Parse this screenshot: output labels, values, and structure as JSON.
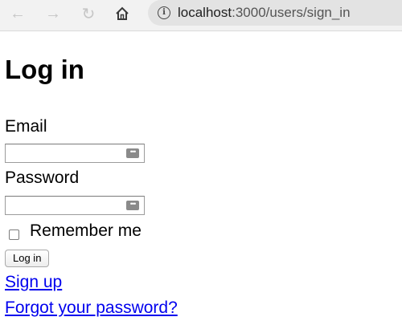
{
  "browser": {
    "back_icon": "←",
    "forward_icon": "→",
    "reload_icon": "↻",
    "home_icon": "⌂",
    "url_host": "localhost",
    "url_path": ":3000/users/sign_in"
  },
  "page": {
    "title": "Log in",
    "email_label": "Email",
    "email_value": "",
    "password_label": "Password",
    "password_value": "",
    "remember_label": "Remember me",
    "remember_checked": false,
    "submit_label": "Log in",
    "links": {
      "sign_up": "Sign up",
      "forgot_password": "Forgot your password?"
    }
  },
  "colors": {
    "link": "#0000ee",
    "toolbar_bg": "#f2f2f2",
    "omnibox_bg": "#e3e3e3"
  }
}
